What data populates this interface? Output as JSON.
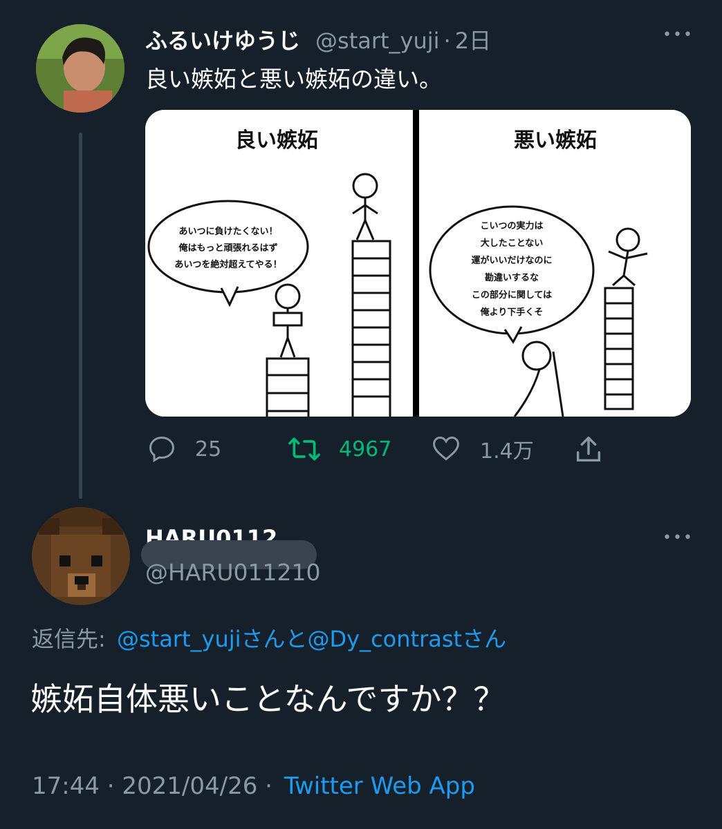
{
  "tweet": {
    "author_name": "ふるいけゆうじ",
    "author_handle": "@start_yuji",
    "separator": "·",
    "time_ago": "2日",
    "text": "良い嫉妬と悪い嫉妬の違い。",
    "image": {
      "left_title": "良い嫉妬",
      "left_bubble": [
        "あいつに負けたくない！",
        "俺はもっと頑張れるはず",
        "あいつを絶対超えてやる！"
      ],
      "right_title": "悪い嫉妬",
      "right_bubble": [
        "こいつの実力は",
        "大したことない",
        "運がいいだけなのに",
        "勘違いするな",
        "この部分に関しては",
        "俺より下手くそ"
      ]
    },
    "actions": {
      "reply_count": "25",
      "retweet_count": "4967",
      "like_count": "1.4万"
    }
  },
  "reply": {
    "author_name": "HARU0112",
    "author_handle": "@HARU011210",
    "reply_to_label": "返信先:",
    "reply_to": "@start_yujiさんと@Dy_contrastさん",
    "text": "嫉妬自体悪いことなんですか？？",
    "timestamp": "17:44 · 2021/04/26 ·",
    "source": "Twitter Web App"
  },
  "colors": {
    "background": "#15202b",
    "accent": "#1d9bf0",
    "retweet": "#00ba7c",
    "muted": "#8b98a5"
  }
}
